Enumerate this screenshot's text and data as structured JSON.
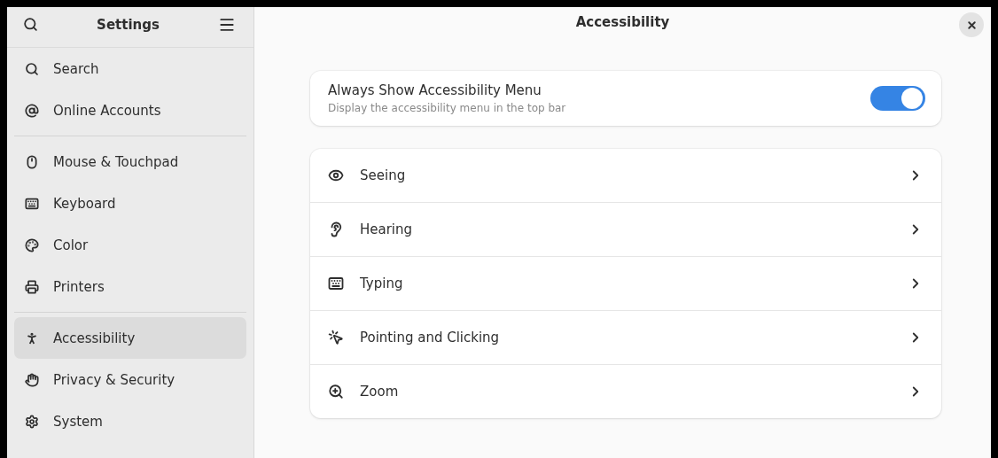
{
  "sidebar": {
    "title": "Settings",
    "groups": [
      [
        {
          "label": "Search",
          "selected": false
        },
        {
          "label": "Online Accounts",
          "selected": false
        }
      ],
      [
        {
          "label": "Mouse & Touchpad",
          "selected": false
        },
        {
          "label": "Keyboard",
          "selected": false
        },
        {
          "label": "Color",
          "selected": false
        },
        {
          "label": "Printers",
          "selected": false
        }
      ],
      [
        {
          "label": "Accessibility",
          "selected": true
        },
        {
          "label": "Privacy & Security",
          "selected": false
        },
        {
          "label": "System",
          "selected": false
        }
      ]
    ]
  },
  "main": {
    "title": "Accessibility",
    "toggle_row": {
      "title": "Always Show Accessibility Menu",
      "subtitle": "Display the accessibility menu in the top bar",
      "on": true
    },
    "rows": [
      {
        "label": "Seeing"
      },
      {
        "label": "Hearing"
      },
      {
        "label": "Typing"
      },
      {
        "label": "Pointing and Clicking"
      },
      {
        "label": "Zoom"
      }
    ]
  }
}
